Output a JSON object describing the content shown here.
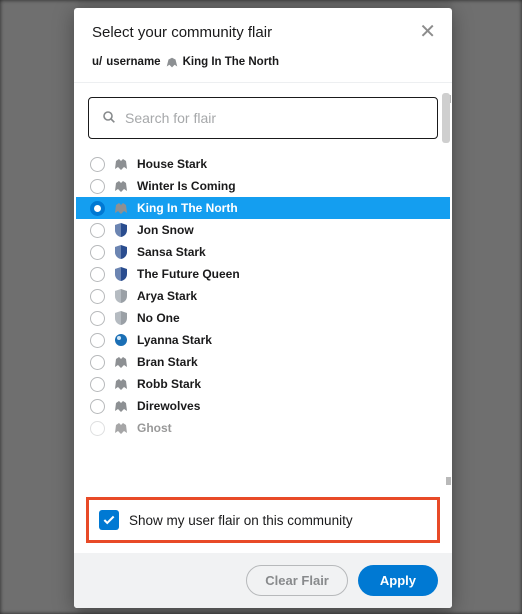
{
  "modal": {
    "title": "Select your community flair",
    "close_glyph": "✕"
  },
  "user": {
    "prefix": "u/",
    "name": "username",
    "flair_text": "King In The North"
  },
  "search": {
    "placeholder": "Search for flair"
  },
  "flairs": [
    {
      "label": "House Stark",
      "icon": "wolf-gray",
      "selected": false
    },
    {
      "label": "Winter Is Coming",
      "icon": "wolf-gray",
      "selected": false
    },
    {
      "label": "King In The North",
      "icon": "wolf-gray",
      "selected": true
    },
    {
      "label": "Jon Snow",
      "icon": "shield-blue",
      "selected": false
    },
    {
      "label": "Sansa Stark",
      "icon": "shield-blue",
      "selected": false
    },
    {
      "label": "The Future Queen",
      "icon": "shield-blue",
      "selected": false
    },
    {
      "label": "Arya Stark",
      "icon": "shield-gray",
      "selected": false
    },
    {
      "label": "No One",
      "icon": "shield-gray",
      "selected": false
    },
    {
      "label": "Lyanna Stark",
      "icon": "orb-blue",
      "selected": false
    },
    {
      "label": "Bran Stark",
      "icon": "wolf-gray",
      "selected": false
    },
    {
      "label": "Robb Stark",
      "icon": "wolf-gray",
      "selected": false
    },
    {
      "label": "Direwolves",
      "icon": "wolf-gray",
      "selected": false
    },
    {
      "label": "Ghost",
      "icon": "wolf-dark",
      "selected": false,
      "cutoff": true
    }
  ],
  "checkbox": {
    "label": "Show my user flair on this community",
    "checked": true
  },
  "footer": {
    "clear_label": "Clear Flair",
    "apply_label": "Apply"
  },
  "icons": {
    "wolf-gray": "#8d9093",
    "wolf-dark": "#3b3c3d",
    "shield-blue": "#2a4d8f",
    "shield-gray": "#9aa0a6",
    "orb-blue": "#1b6fb5"
  }
}
